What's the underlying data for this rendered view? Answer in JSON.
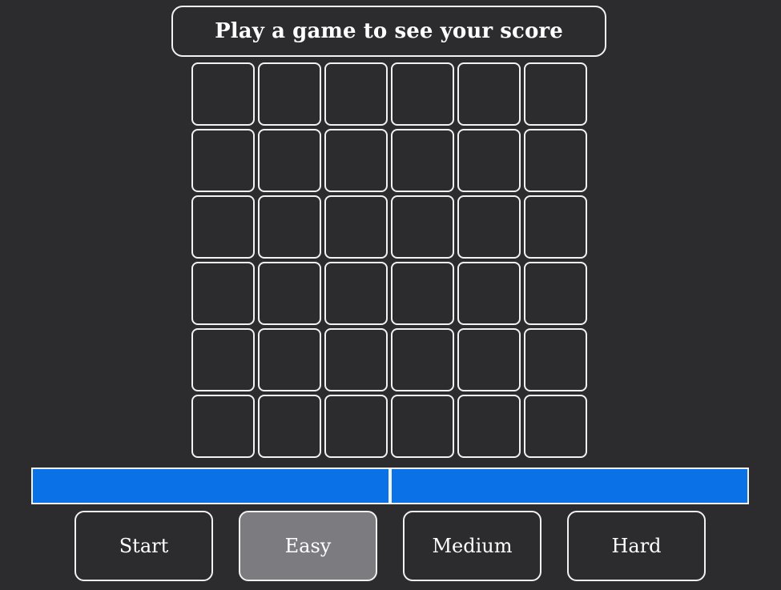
{
  "score_message": "Play a game to see your score",
  "grid": {
    "rows": 6,
    "cols": 6
  },
  "progress": {
    "segments": 2,
    "color": "#0a72e6"
  },
  "controls": {
    "start_label": "Start",
    "easy_label": "Easy",
    "medium_label": "Medium",
    "hard_label": "Hard",
    "selected": "Easy"
  },
  "colors": {
    "background": "#2c2c2e",
    "border": "#f2f2f2",
    "selected": "#7c7b80"
  }
}
